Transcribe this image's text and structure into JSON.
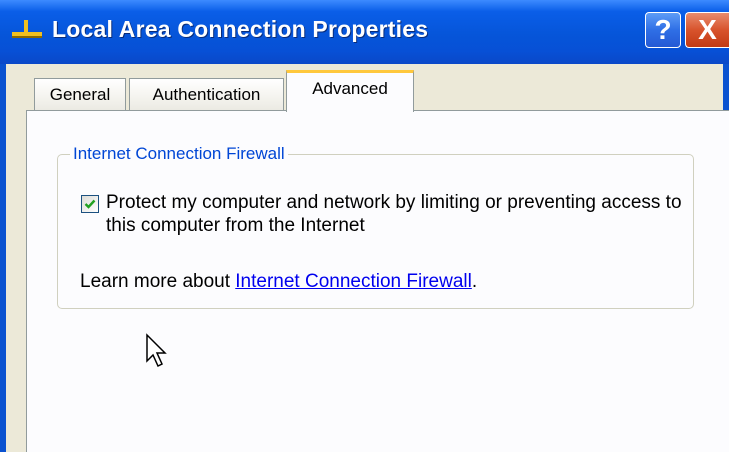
{
  "window": {
    "title": "Local Area Connection Properties",
    "help_button": "?",
    "close_button": "X"
  },
  "tabs": [
    {
      "label": "General",
      "selected": false
    },
    {
      "label": "Authentication",
      "selected": false
    },
    {
      "label": "Advanced",
      "selected": true
    }
  ],
  "firewall_group": {
    "title": "Internet Connection Firewall",
    "checkbox": {
      "label": "Protect my computer and network by limiting or preventing access to this computer from the Internet",
      "checked": true
    },
    "learn_more_prefix": "Learn more about ",
    "learn_more_link": "Internet Connection Firewall",
    "learn_more_suffix": "."
  },
  "colors": {
    "titlebar": "#0655d9",
    "group_title": "#0046d5",
    "link": "#0000ee",
    "close_button": "#d8532c"
  }
}
